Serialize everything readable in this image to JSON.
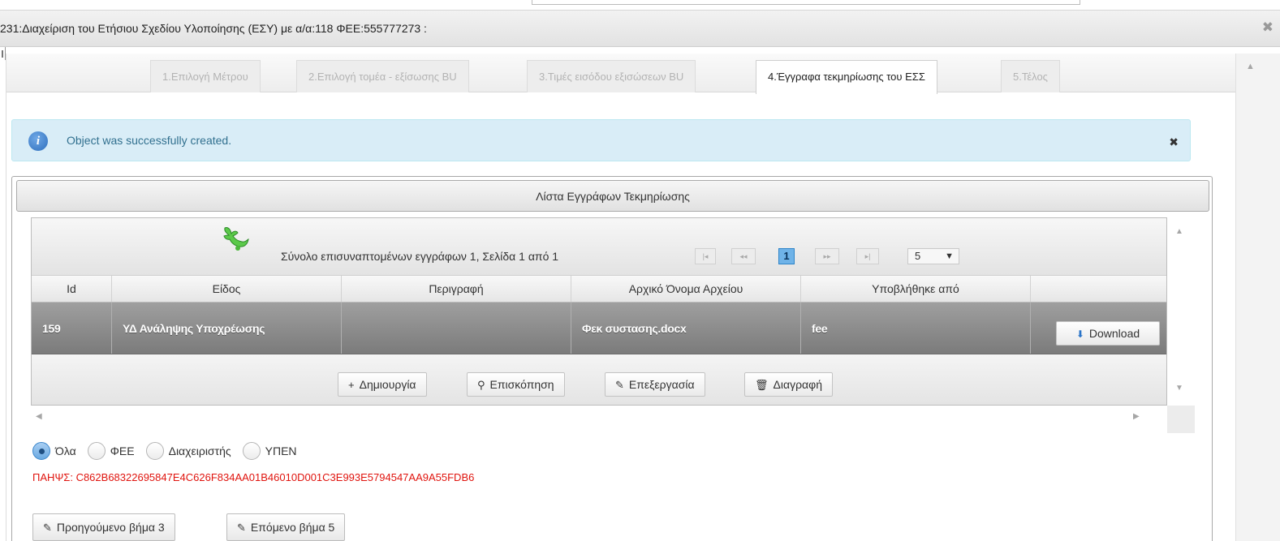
{
  "dialog": {
    "title": "231:Διαχείριση του Ετήσιου Σχεδίου Υλοποίησης (ΕΣΥ) με α/α:118 ΦΕΕ:555777273 :",
    "close_symbol": "✖"
  },
  "tabs": [
    {
      "label": "1.Επιλογή Μέτρου",
      "active": false
    },
    {
      "label": "2.Επιλογή τομέα - εξίσωσης BU",
      "active": false
    },
    {
      "label": "3.Τιμές εισόδου εξισώσεων BU",
      "active": false
    },
    {
      "label": "4.Έγγραφα τεκμηρίωσης του ΕΣΣ",
      "active": true
    },
    {
      "label": "5.Τέλος",
      "active": false
    }
  ],
  "alert": {
    "message": "Object was successfully created.",
    "icon": "info-icon",
    "close_symbol": "✖"
  },
  "panel": {
    "title": "Λίστα Εγγράφων Τεκμηρίωσης"
  },
  "grid": {
    "summary": "Σύνολο επισυναπτομένων εγγράφων 1, Σελίδα 1 από 1",
    "paginator": {
      "first": "|◂",
      "prev": "◂◂",
      "current_page": "1",
      "next": "▸▸",
      "last": "▸|",
      "rows_per_page": "5",
      "chevron": "▼"
    },
    "columns": [
      "Id",
      "Είδος",
      "Περιγραφή",
      "Αρχικό Όνομα Αρχείου",
      "Υποβλήθηκε από",
      ""
    ],
    "rows": [
      {
        "id": "159",
        "type": "ΥΔ Ανάληψης Υποχρέωσης",
        "description": "",
        "filename": "Φεκ συστασης.docx",
        "submitted_by": "fee",
        "action": "Download",
        "action_icon": "⬇"
      }
    ],
    "toolbar": {
      "create": "Δημιουργία",
      "create_icon": "+",
      "view": "Επισκόπηση",
      "view_icon": "⚲",
      "edit": "Επεξεργασία",
      "edit_icon": "✎",
      "delete": "Διαγραφή",
      "delete_icon": "🗑"
    }
  },
  "filters": [
    {
      "label": "Όλα",
      "selected": true
    },
    {
      "label": "ΦΕΕ",
      "selected": false
    },
    {
      "label": "Διαχειριστής",
      "selected": false
    },
    {
      "label": "ΥΠΕΝ",
      "selected": false
    }
  ],
  "hash_line": "ΠΑΗΨΣ: C862B68322695847E4C626F834AA01B46010D001C3E993E5794547AA9A55FDB6",
  "navigation": {
    "prev": "Προηγούμενο βήμα 3",
    "next": "Επόμενο βήμα 5",
    "icon": "✎"
  },
  "colors": {
    "alert_bg": "#d9edf7",
    "alert_text": "#31708f",
    "hash_text": "#e0140e",
    "selected_row": "#8a8a8a",
    "accent": "#2d84c9"
  }
}
